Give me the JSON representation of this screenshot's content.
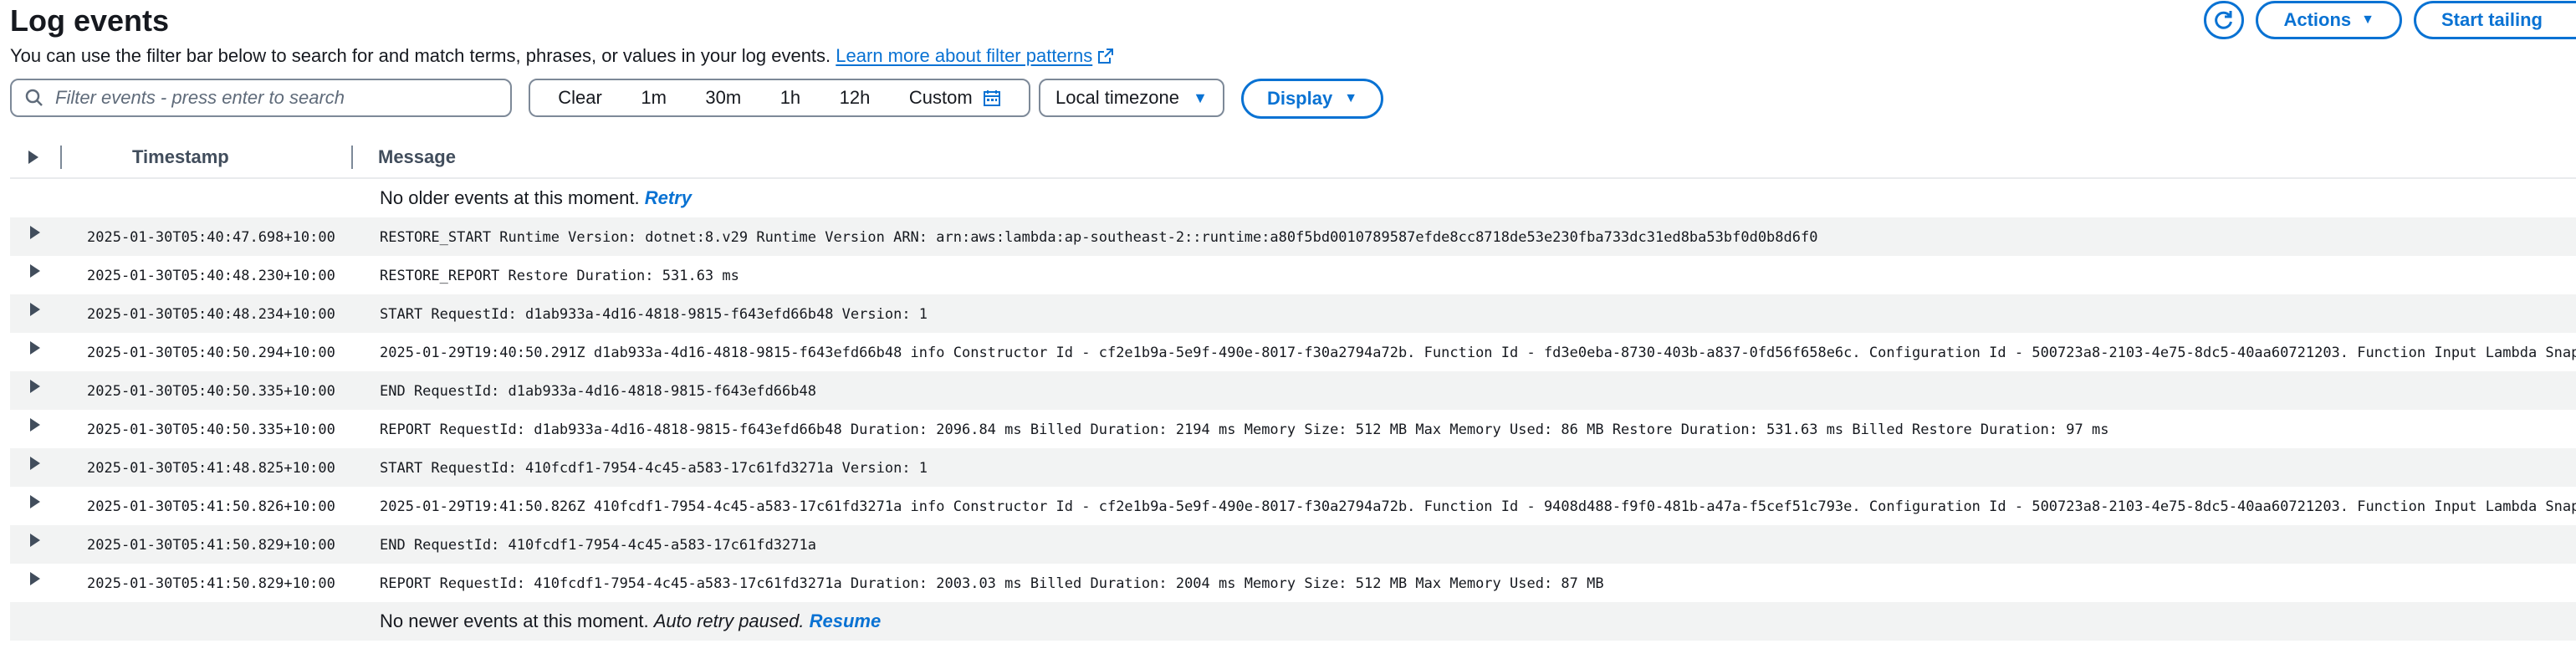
{
  "header": {
    "title": "Log events",
    "subtitle": "You can use the filter bar below to search for and match terms, phrases, or values in your log events.",
    "learn_more": "Learn more about filter patterns"
  },
  "top_actions": {
    "actions_label": "Actions",
    "start_tailing_label": "Start tailing"
  },
  "filter": {
    "placeholder": "Filter events - press enter to search",
    "value": ""
  },
  "time_range": {
    "clear": "Clear",
    "options": [
      "1m",
      "30m",
      "1h",
      "12h"
    ],
    "custom": "Custom"
  },
  "timezone": {
    "selected": "Local timezone"
  },
  "display": {
    "label": "Display"
  },
  "table": {
    "col_timestamp": "Timestamp",
    "col_message": "Message",
    "no_older": {
      "text": "No older events at this moment.",
      "link": "Retry"
    },
    "rows": [
      {
        "ts": "2025-01-30T05:40:47.698+10:00",
        "msg": "RESTORE_START Runtime Version: dotnet:8.v29 Runtime Version ARN: arn:aws:lambda:ap-southeast-2::runtime:a80f5bd0010789587efde8cc8718de53e230fba733dc31ed8ba53bf0d0b8d6f0"
      },
      {
        "ts": "2025-01-30T05:40:48.230+10:00",
        "msg": "RESTORE_REPORT Restore Duration: 531.63 ms"
      },
      {
        "ts": "2025-01-30T05:40:48.234+10:00",
        "msg": "START RequestId: d1ab933a-4d16-4818-9815-f643efd66b48 Version: 1"
      },
      {
        "ts": "2025-01-30T05:40:50.294+10:00",
        "msg": "2025-01-29T19:40:50.291Z d1ab933a-4d16-4818-9815-f643efd66b48 info Constructor Id - cf2e1b9a-5e9f-490e-8017-f30a2794a72b. Function Id - fd3e0eba-8730-403b-a837-0fd56f658e6c. Configuration Id - 500723a8-2103-4e75-8dc5-40aa60721203. Function Input Lambda Snapstart"
      },
      {
        "ts": "2025-01-30T05:40:50.335+10:00",
        "msg": "END RequestId: d1ab933a-4d16-4818-9815-f643efd66b48"
      },
      {
        "ts": "2025-01-30T05:40:50.335+10:00",
        "msg": "REPORT RequestId: d1ab933a-4d16-4818-9815-f643efd66b48 Duration: 2096.84 ms Billed Duration: 2194 ms Memory Size: 512 MB Max Memory Used: 86 MB Restore Duration: 531.63 ms Billed Restore Duration: 97 ms"
      },
      {
        "ts": "2025-01-30T05:41:48.825+10:00",
        "msg": "START RequestId: 410fcdf1-7954-4c45-a583-17c61fd3271a Version: 1"
      },
      {
        "ts": "2025-01-30T05:41:50.826+10:00",
        "msg": "2025-01-29T19:41:50.826Z 410fcdf1-7954-4c45-a583-17c61fd3271a info Constructor Id - cf2e1b9a-5e9f-490e-8017-f30a2794a72b. Function Id - 9408d488-f9f0-481b-a47a-f5cef51c793e. Configuration Id - 500723a8-2103-4e75-8dc5-40aa60721203. Function Input Lambda Snapstart"
      },
      {
        "ts": "2025-01-30T05:41:50.829+10:00",
        "msg": "END RequestId: 410fcdf1-7954-4c45-a583-17c61fd3271a"
      },
      {
        "ts": "2025-01-30T05:41:50.829+10:00",
        "msg": "REPORT RequestId: 410fcdf1-7954-4c45-a583-17c61fd3271a Duration: 2003.03 ms Billed Duration: 2004 ms Memory Size: 512 MB Max Memory Used: 87 MB"
      }
    ],
    "no_newer": {
      "text": "No newer events at this moment.",
      "paused": "Auto retry paused.",
      "link": "Resume"
    }
  },
  "colors": {
    "accent": "#0972d3",
    "text": "#16191f",
    "row_alt": "#f2f3f3",
    "border": "#7d8998"
  }
}
